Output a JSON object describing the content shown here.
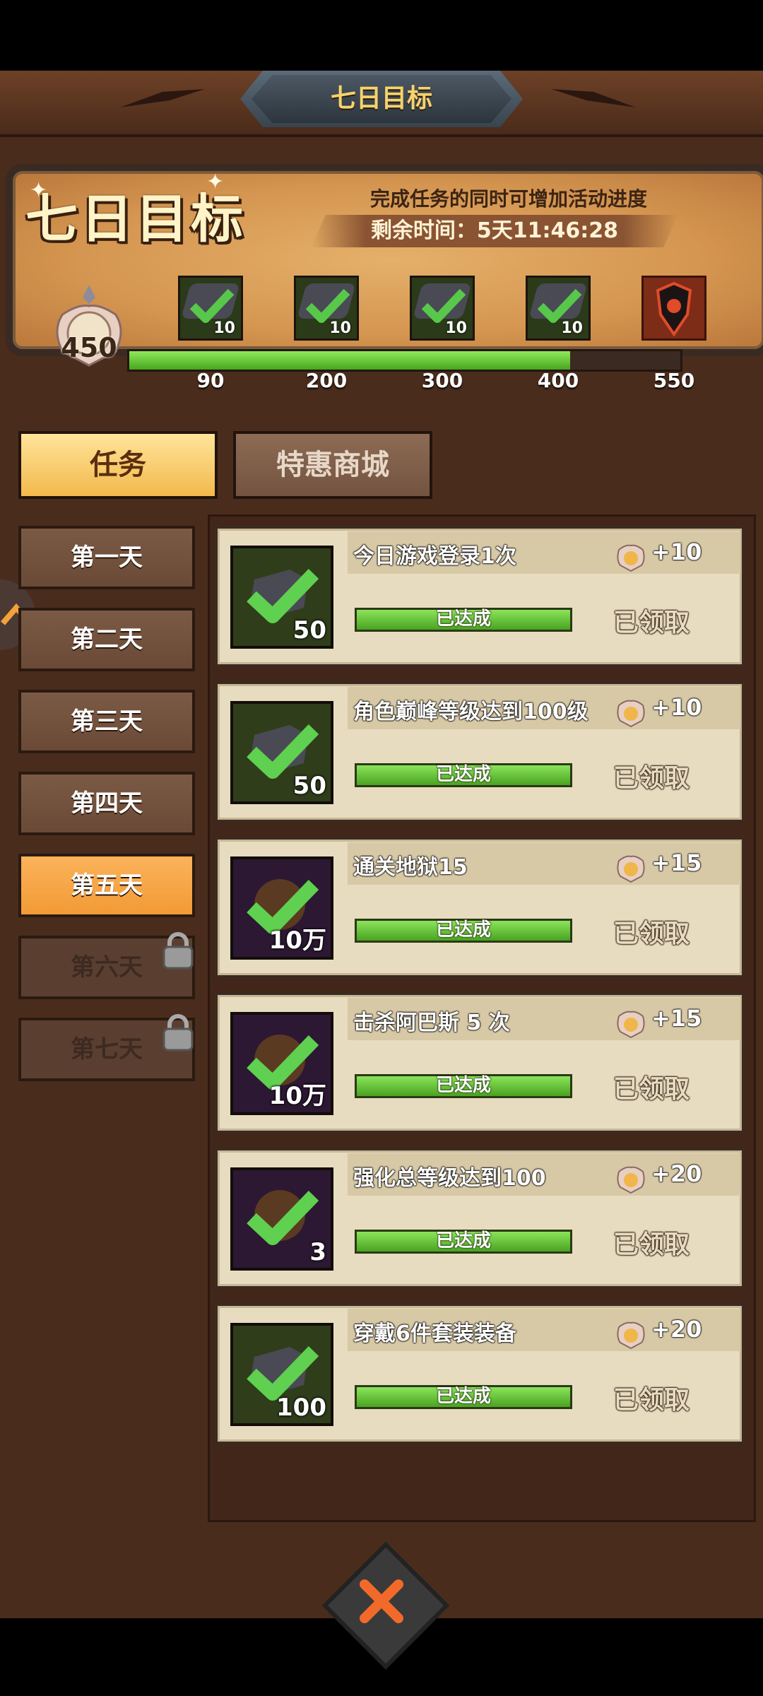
{
  "header": {
    "title": "七日目标"
  },
  "panel": {
    "big_title": "七日目标",
    "subtitle": "完成任务的同时可增加活动进度",
    "timer_label": "剩余时间：5天11:46:28",
    "points": "450",
    "progress_fraction": 0.8,
    "milestones": [
      {
        "label": "90",
        "count": "10",
        "status": "done"
      },
      {
        "label": "200",
        "count": "10",
        "status": "done"
      },
      {
        "label": "300",
        "count": "10",
        "status": "done"
      },
      {
        "label": "400",
        "count": "10",
        "status": "done"
      },
      {
        "label": "550",
        "count": "",
        "status": "reward"
      }
    ]
  },
  "tabs": [
    {
      "label": "任务",
      "active": true
    },
    {
      "label": "特惠商城",
      "active": false
    }
  ],
  "days": [
    {
      "label": "第一天",
      "state": "normal"
    },
    {
      "label": "第二天",
      "state": "normal"
    },
    {
      "label": "第三天",
      "state": "normal"
    },
    {
      "label": "第四天",
      "state": "normal"
    },
    {
      "label": "第五天",
      "state": "active"
    },
    {
      "label": "第六天",
      "state": "locked"
    },
    {
      "label": "第七天",
      "state": "locked"
    }
  ],
  "tasks": [
    {
      "name": "今日游戏登录1次",
      "points": "+10",
      "count": "50",
      "bar_text": "已达成",
      "status": "已领取",
      "icon_bg": "olive"
    },
    {
      "name": "角色巅峰等级达到100级",
      "points": "+10",
      "count": "50",
      "bar_text": "已达成",
      "status": "已领取",
      "icon_bg": "olive"
    },
    {
      "name": "通关地狱15",
      "points": "+15",
      "count": "10万",
      "bar_text": "已达成",
      "status": "已领取",
      "icon_bg": "purple"
    },
    {
      "name": "击杀阿巴斯 5 次",
      "points": "+15",
      "count": "10万",
      "bar_text": "已达成",
      "status": "已领取",
      "icon_bg": "purple"
    },
    {
      "name": "强化总等级达到100",
      "points": "+20",
      "count": "3",
      "bar_text": "已达成",
      "status": "已领取",
      "icon_bg": "purple"
    },
    {
      "name": "穿戴6件套装装备",
      "points": "+20",
      "count": "100",
      "bar_text": "已达成",
      "status": "已领取",
      "icon_bg": "olive"
    }
  ],
  "colors": {
    "accent_gold": "#f6d36b",
    "progress_green": "#6cc43a",
    "active_day": "#f29a36"
  }
}
